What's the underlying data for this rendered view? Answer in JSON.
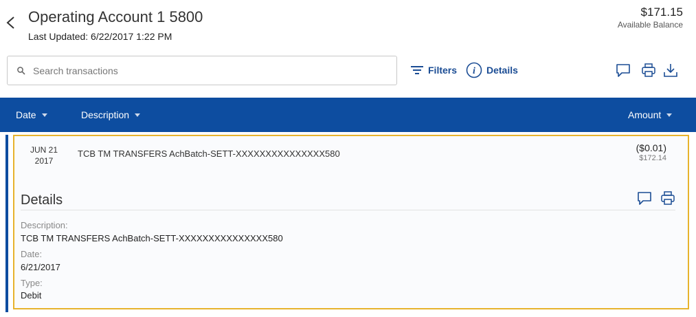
{
  "account": {
    "title": "Operating Account 1 5800",
    "last_updated": "Last Updated: 6/22/2017 1:22 PM",
    "balance": "$171.15",
    "balance_label": "Available Balance"
  },
  "toolbar": {
    "search_placeholder": "Search transactions",
    "filters_label": "Filters",
    "details_label": "Details"
  },
  "table_header": {
    "date": "Date",
    "description": "Description",
    "amount": "Amount"
  },
  "transaction": {
    "date_month_day": "JUN 21",
    "date_year": "2017",
    "description": "TCB TM TRANSFERS AchBatch-SETT-XXXXXXXXXXXXXXX580",
    "amount": "($0.01)",
    "running_balance": "$172.14",
    "details_heading": "Details",
    "fields": [
      {
        "label": "Description:",
        "value": "TCB TM TRANSFERS AchBatch-SETT-XXXXXXXXXXXXXXX580"
      },
      {
        "label": "Date:",
        "value": "6/21/2017"
      },
      {
        "label": "Type:",
        "value": "Debit"
      }
    ]
  },
  "colors": {
    "brand_blue": "#0d4da0",
    "link_blue": "#1a4c94",
    "highlight_border": "#e7b32c"
  },
  "icons": [
    "back-chevron-icon",
    "search-icon",
    "filter-icon",
    "info-icon",
    "comment-icon",
    "print-icon",
    "download-icon"
  ]
}
